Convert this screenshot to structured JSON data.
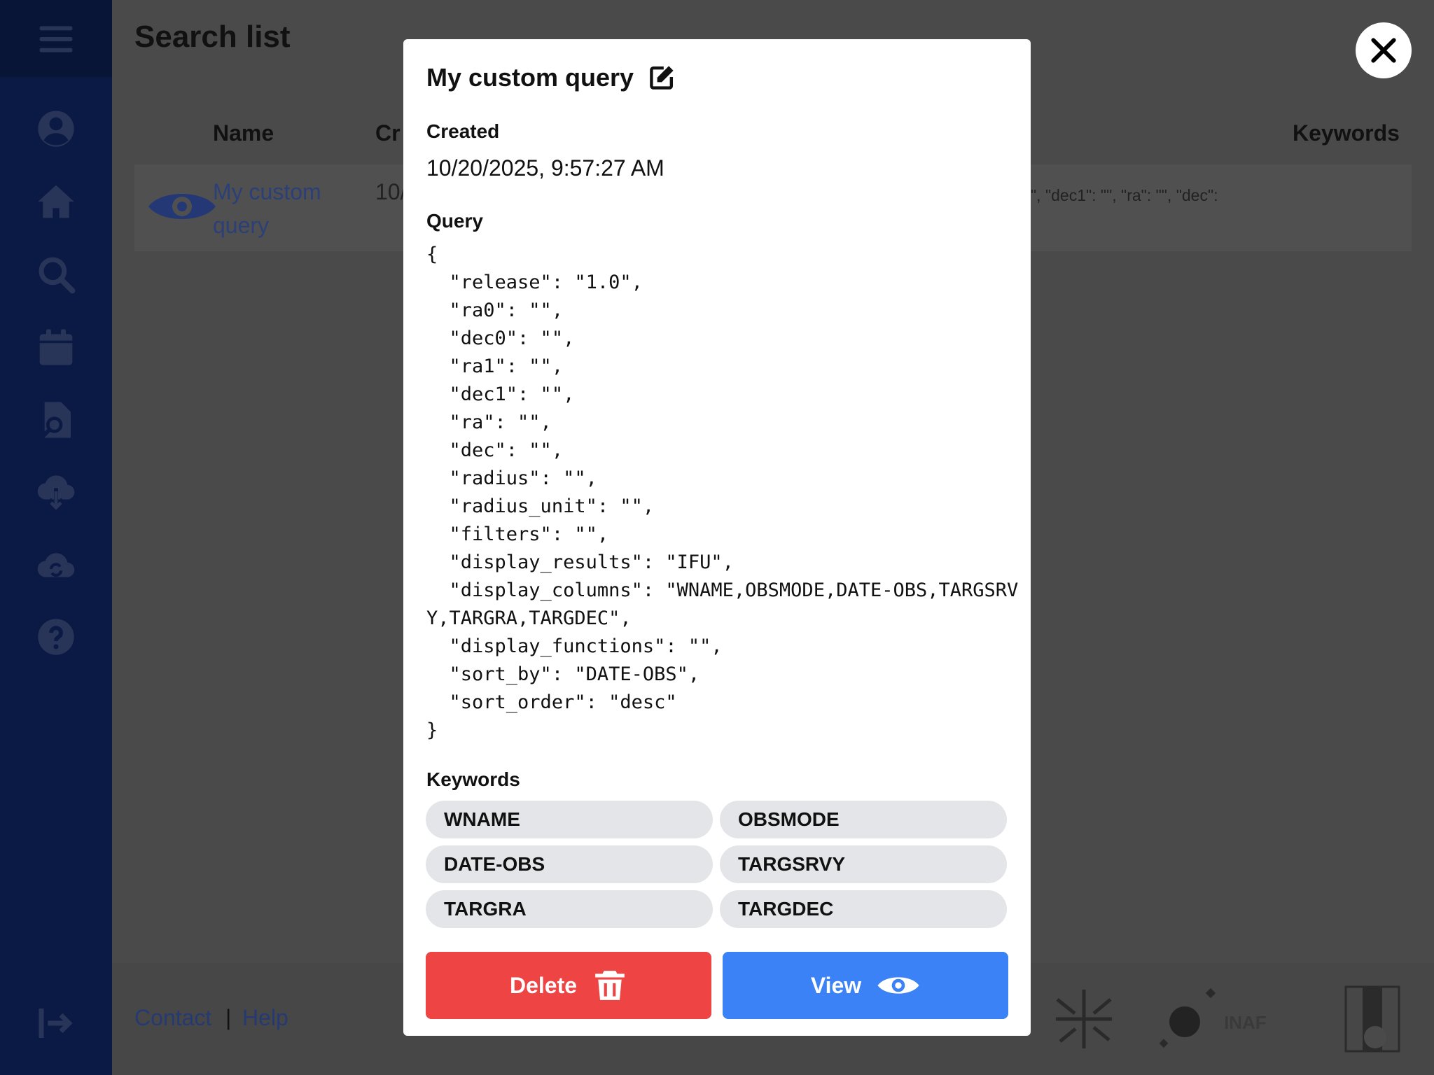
{
  "page": {
    "title": "Search list"
  },
  "table": {
    "headers": {
      "name": "Name",
      "created": "Cr",
      "keywords": "Keywords"
    },
    "row": {
      "name": "My custom query",
      "date_fragment": "10/ 9:5",
      "query_preview": "\", \"dec1\": \"\", \"ra\": \"\", \"dec\":"
    }
  },
  "sidebar": {
    "icons": [
      "menu-icon",
      "user-circle-icon",
      "home-icon",
      "search-icon",
      "calendar-icon",
      "file-search-icon",
      "cloud-download-icon",
      "cloud-sync-icon",
      "help-icon",
      "logout-icon"
    ]
  },
  "footer": {
    "contact": "Contact",
    "separator": "|",
    "help": "Help",
    "logo_text": "INAF"
  },
  "modal": {
    "title": "My custom query",
    "created_label": "Created",
    "created_value": "10/20/2025, 9:57:27 AM",
    "query_label": "Query",
    "query_json": "{\n  \"release\": \"1.0\",\n  \"ra0\": \"\",\n  \"dec0\": \"\",\n  \"ra1\": \"\",\n  \"dec1\": \"\",\n  \"ra\": \"\",\n  \"dec\": \"\",\n  \"radius\": \"\",\n  \"radius_unit\": \"\",\n  \"filters\": \"\",\n  \"display_results\": \"IFU\",\n  \"display_columns\": \"WNAME,OBSMODE,DATE-OBS,TARGSRVY,TARGRA,TARGDEC\",\n  \"display_functions\": \"\",\n  \"sort_by\": \"DATE-OBS\",\n  \"sort_order\": \"desc\"\n}",
    "keywords_label": "Keywords",
    "keywords": [
      "WNAME",
      "OBSMODE",
      "DATE-OBS",
      "TARGSRVY",
      "TARGRA",
      "TARGDEC"
    ],
    "delete_label": "Delete",
    "view_label": "View"
  },
  "colors": {
    "delete": "#ef4444",
    "view": "#3b82f6",
    "sidebar": "#0b1a44"
  }
}
